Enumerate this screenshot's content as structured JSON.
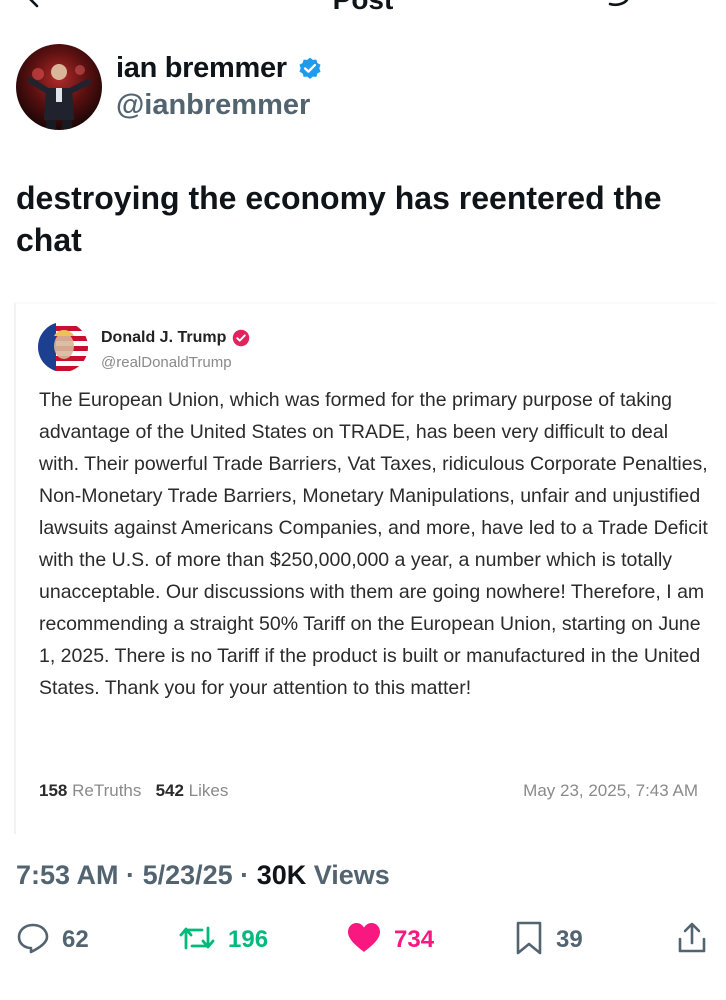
{
  "header": {
    "title": "Post"
  },
  "author": {
    "name": "ian bremmer",
    "handle": "@ianbremmer",
    "verified_color": "#1d9bf0"
  },
  "post": {
    "text": "destroying the economy has reentered the chat"
  },
  "embed": {
    "name": "Donald J. Trump",
    "handle": "@realDonaldTrump",
    "badge_color": "#e0245e",
    "body": "The European Union, which was formed for the primary purpose of taking advantage of the United States on TRADE, has been very difficult to deal with. Their powerful Trade Barriers, Vat Taxes, ridiculous Corporate Penalties, Non-Monetary Trade Barriers, Monetary Manipulations, unfair and unjustified lawsuits against Americans Companies, and more, have led to a Trade Deficit with the U.S. of more than $250,000,000 a year, a number which is totally unacceptable. Our discussions with them are going nowhere! Therefore, I am recommending a straight 50% Tariff on the European Union, starting on June 1, 2025. There is no Tariff if the product is built or manufactured in the United States. Thank you for your attention to this matter!",
    "retruths_count": "158",
    "retruths_label": "ReTruths",
    "likes_count": "542",
    "likes_label": "Likes",
    "date": "May 23, 2025, 7:43 AM"
  },
  "meta": {
    "time": "7:53 AM",
    "date": "5/23/25",
    "views_count": "30K",
    "views_label": "Views"
  },
  "actions": {
    "replies": "62",
    "reposts": "196",
    "likes": "734",
    "bookmarks": "39"
  },
  "colors": {
    "repost": "#00ba7c",
    "like": "#f91880",
    "muted": "#536471"
  }
}
